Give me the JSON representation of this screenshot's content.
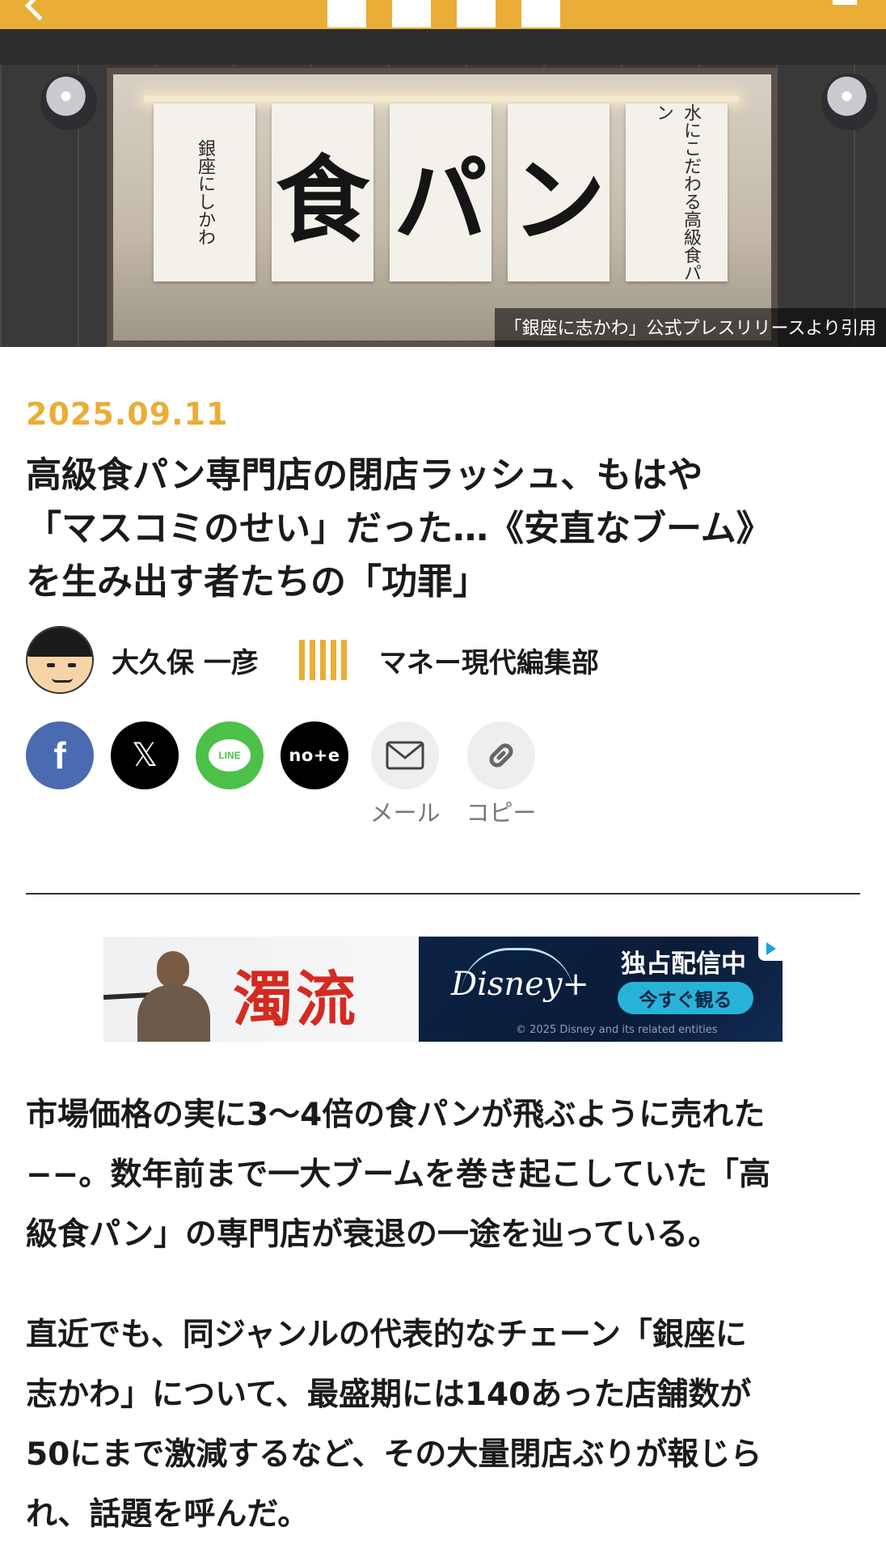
{
  "hero": {
    "noren": {
      "left": "銀座にしかわ",
      "kanji1": "食",
      "kanji2": "パ",
      "kanji3": "ン",
      "right": "水にこだわる高級食パン"
    },
    "credit": "「銀座に志かわ」公式プレスリリースより引用"
  },
  "article": {
    "date": "2025.09.11",
    "title_lines": [
      "高級食パン専門店の閉店ラッシュ、もはや",
      "「マスコミのせい」だった…《安直なブーム》",
      "を生み出す者たちの「功罪」"
    ],
    "author": "大久保 一彦",
    "department": "マネー現代編集部"
  },
  "share": {
    "facebook_glyph": "f",
    "x_glyph": "𝕏",
    "line_glyph": "LINE",
    "note_glyph": "no+e",
    "mail_label": "メール",
    "copy_label": "コピー"
  },
  "ad": {
    "brand": "濁流",
    "streamer": "Disney+",
    "headline": "独占配信中",
    "cta": "今すぐ観る",
    "copyright": "© 2025 Disney and its related entities"
  },
  "body": {
    "paragraph1": [
      "市場価格の実に3〜4倍の食パンが飛ぶように売れた",
      "−−。数年前まで一大ブームを巻き起こしていた「高",
      "級食パン」の専門店が衰退の一途を辿っている。"
    ],
    "paragraph2": [
      "直近でも、同ジャンルの代表的なチェーン「銀座に",
      "志かわ」について、最盛期には140あった店舗数が",
      "50にまで激減するなど、その大量閉店ぶりが報じら",
      "れ、話題を呼んだ。"
    ]
  },
  "colors": {
    "accent": "#e9ad38",
    "facebook": "#4b6bb1",
    "line": "#4cc14a",
    "text": "#1a1a1a"
  }
}
